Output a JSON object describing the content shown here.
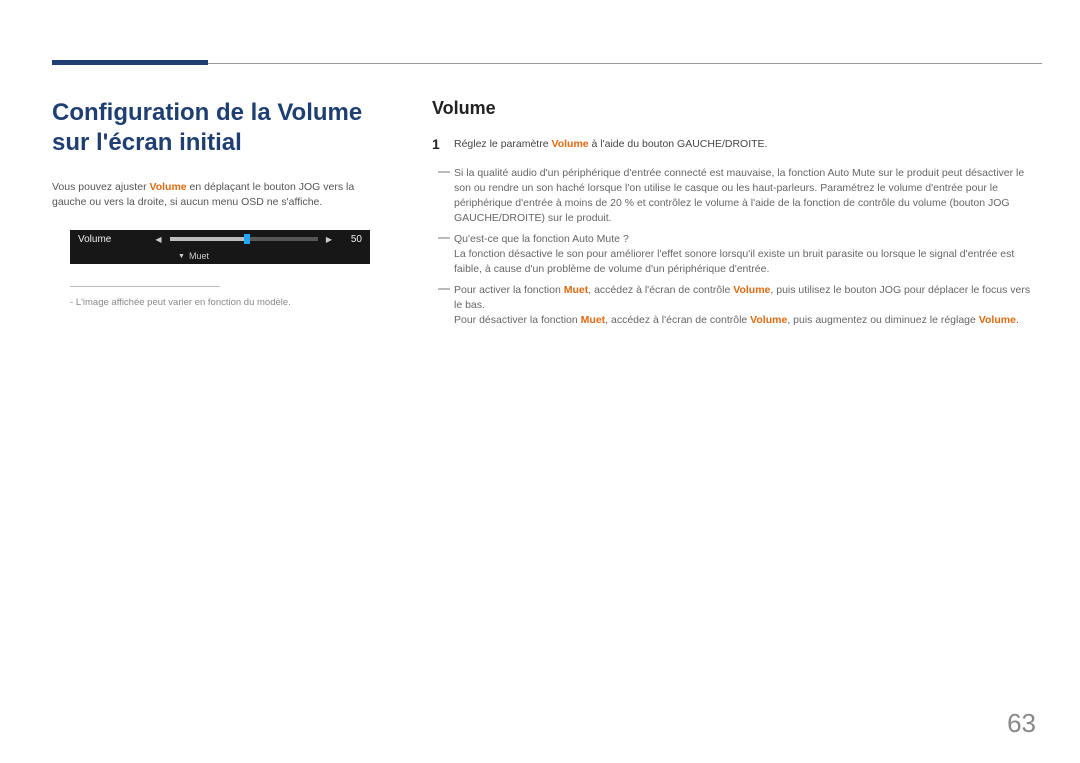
{
  "left": {
    "heading": "Configuration de la Volume sur l'écran initial",
    "intro_pre": "Vous pouvez ajuster ",
    "intro_bold": "Volume",
    "intro_post": " en déplaçant le bouton JOG vers la gauche ou vers la droite, si aucun menu OSD ne s'affiche.",
    "osd": {
      "label": "Volume",
      "value": "50",
      "mute": "Muet"
    },
    "footnote": "L'image affichée peut varier en fonction du modèle."
  },
  "right": {
    "heading": "Volume",
    "step1_pre": "Réglez le paramètre ",
    "step1_bold": "Volume",
    "step1_post": " à l'aide du bouton GAUCHE/DROITE.",
    "info1": "Si la qualité audio d'un périphérique d'entrée connecté est mauvaise, la fonction Auto Mute sur le produit peut désactiver le son ou rendre un son haché lorsque l'on utilise le casque ou les haut-parleurs. Paramétrez le volume d'entrée pour le périphérique d'entrée à moins de 20 % et contrôlez le volume à l'aide de la fonction de contrôle du volume (bouton JOG GAUCHE/DROITE) sur le produit.",
    "info2_q": "Qu'est-ce que la fonction Auto Mute ?",
    "info2_a": "La fonction désactive le son pour améliorer l'effet sonore lorsqu'il existe un bruit parasite ou lorsque le signal d'entrée est faible, à cause d'un problème de volume d'un périphérique d'entrée.",
    "info3_a": "Pour activer la fonction ",
    "info3_b": "Muet",
    "info3_c": ", accédez à l'écran de contrôle ",
    "info3_d": "Volume",
    "info3_e": ", puis utilisez le bouton JOG pour déplacer le focus vers le bas.",
    "info3_f": "Pour désactiver la fonction ",
    "info3_g": "Muet",
    "info3_h": ", accédez à l'écran de contrôle ",
    "info3_i": "Volume",
    "info3_j": ", puis augmentez ou diminuez le réglage ",
    "info3_k": "Volume",
    "info3_l": "."
  },
  "page_number": "63"
}
